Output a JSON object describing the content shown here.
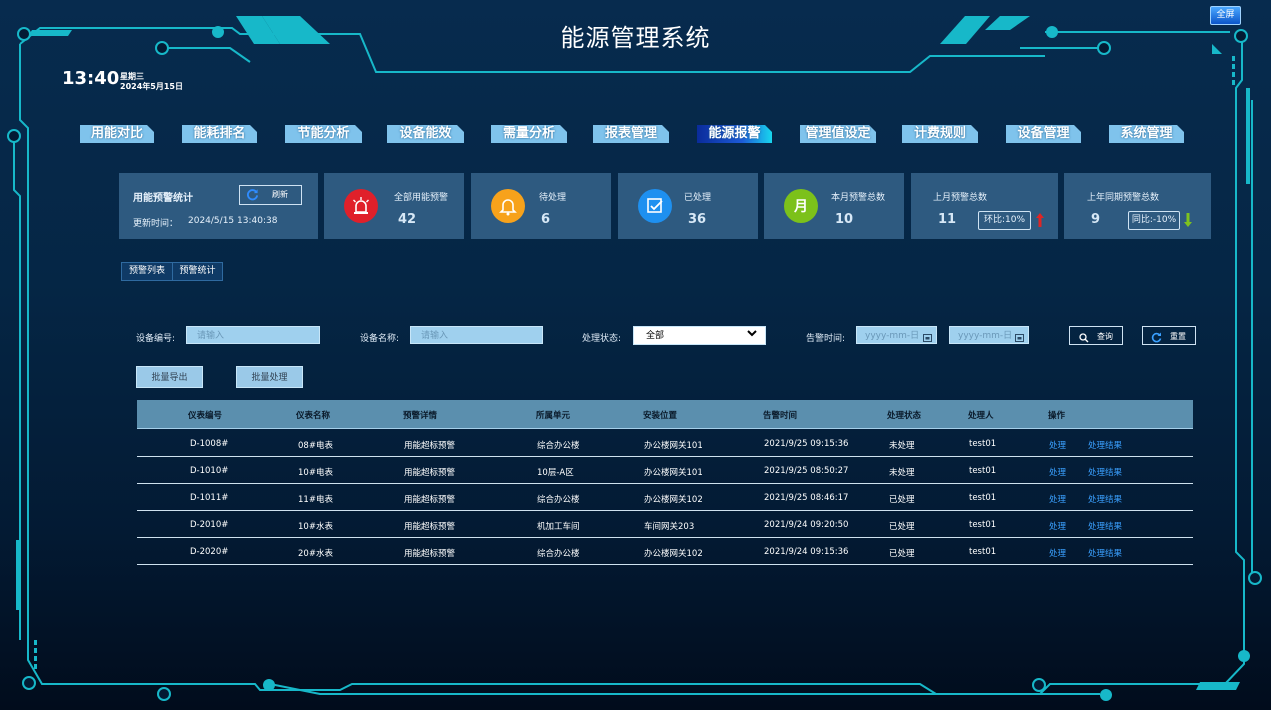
{
  "header": {
    "title": "能源管理系统",
    "fullscreen_label": "全屏",
    "time": "13:40",
    "weekday": "星期三",
    "date": "2024年5月15日"
  },
  "nav": [
    "用能对比",
    "能耗排名",
    "节能分析",
    "设备能效",
    "需量分析",
    "报表管理",
    "能源报警",
    "管理值设定",
    "计费规则",
    "设备管理",
    "系统管理"
  ],
  "nav_active": "能源报警",
  "stats": {
    "panel_title": "用能预警统计",
    "refresh_label": "刷新",
    "updated_label": "更新时间：",
    "updated_value": "2024/5/15 13:40:38",
    "all_label": "全部用能预警",
    "all_value": "42",
    "pending_label": "待处理",
    "pending_value": "6",
    "done_label": "已处理",
    "done_value": "36",
    "month_label": "本月预警总数",
    "month_value": "10",
    "month_icon_char": "月",
    "lastmonth_label": "上月预警总数",
    "lastmonth_value": "11",
    "lastmonth_cmp": "环比:10%",
    "lastyear_label": "上年同期预警总数",
    "lastyear_value": "9",
    "lastyear_cmp": "同比:-10%",
    "colors": {
      "all": "#e0202a",
      "pending": "#f7a21b",
      "done": "#1e90f0",
      "month": "#7cc11a",
      "up": "#e02525",
      "down": "#7ec21e"
    }
  },
  "subtabs": [
    "预警列表",
    "预警统计"
  ],
  "filters": {
    "device_no_label": "设备编号:",
    "device_no_placeholder": "请输入",
    "device_name_label": "设备名称:",
    "device_name_placeholder": "请输入",
    "status_label": "处理状态:",
    "status_value": "全部",
    "time_label": "告警时间:",
    "date_placeholder_1": "yyyy-mm-日",
    "date_placeholder_2": "yyyy-mm-日",
    "query_label": "查询",
    "reset_label": "重置",
    "export_label": "批量导出",
    "batch_label": "批量处理"
  },
  "table": {
    "headers": [
      "仪表编号",
      "仪表名称",
      "预警详情",
      "所属单元",
      "安装位置",
      "告警时间",
      "处理状态",
      "处理人",
      "操作"
    ],
    "rows": [
      [
        "D-1008#",
        "08#电表",
        "用能超标预警",
        "综合办公楼",
        "办公楼网关101",
        "2021/9/25 09:15:36",
        "未处理",
        "test01",
        "处理",
        "处理结果"
      ],
      [
        "D-1010#",
        "10#电表",
        "用能超标预警",
        "10层-A区",
        "办公楼网关101",
        "2021/9/25 08:50:27",
        "未处理",
        "test01",
        "处理",
        "处理结果"
      ],
      [
        "D-1011#",
        "11#电表",
        "用能超标预警",
        "综合办公楼",
        "办公楼网关102",
        "2021/9/25 08:46:17",
        "已处理",
        "test01",
        "处理",
        "处理结果"
      ],
      [
        "D-2010#",
        "10#水表",
        "用能超标预警",
        "机加工车间",
        "车间网关203",
        "2021/9/24 09:20:50",
        "已处理",
        "test01",
        "处理",
        "处理结果"
      ],
      [
        "D-2020#",
        "20#水表",
        "用能超标预警",
        "综合办公楼",
        "办公楼网关102",
        "2021/9/24 09:15:36",
        "已处理",
        "test01",
        "处理",
        "处理结果"
      ]
    ]
  }
}
